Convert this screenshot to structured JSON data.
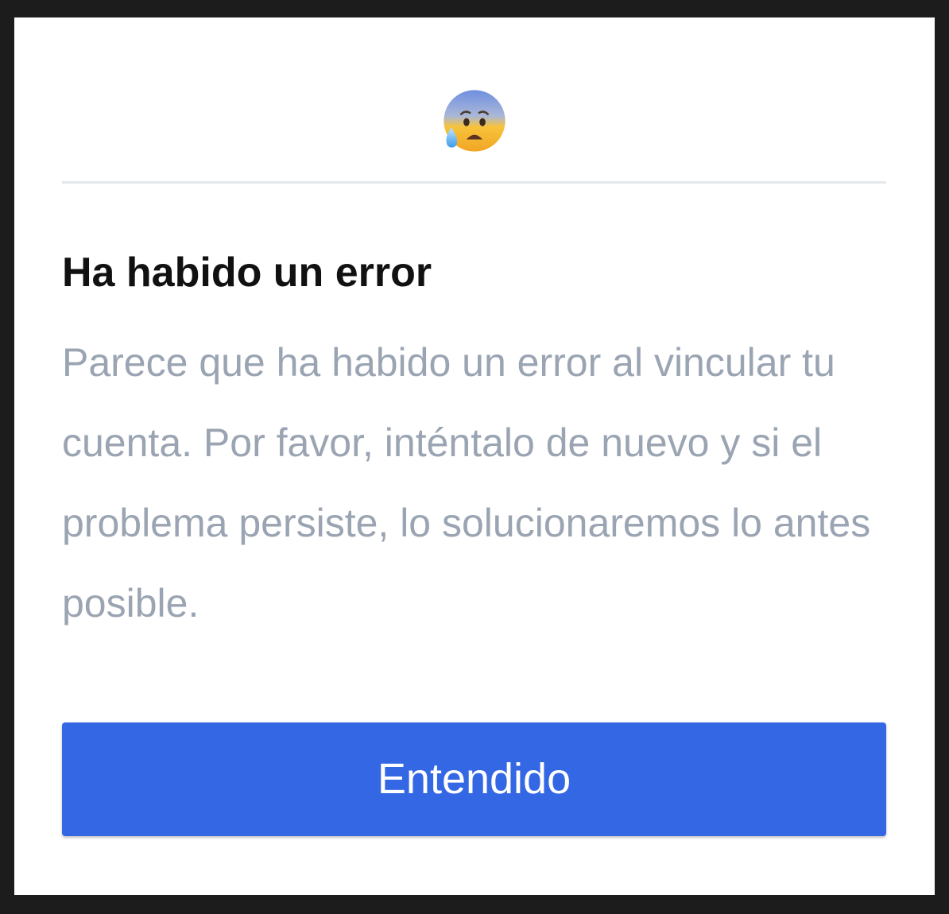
{
  "dialog": {
    "icon": "anxious-face-with-sweat-icon",
    "title": "Ha habido un error",
    "message": "Parece que ha habido un error al vincular tu cuenta. Por favor, inténtalo de nuevo y si el problema persiste, lo solucionaremos lo antes posible.",
    "button_label": "Entendido"
  },
  "colors": {
    "accent": "#3367e4",
    "title": "#111111",
    "message": "#9aa4b2",
    "backdrop": "#1c1c1c"
  }
}
